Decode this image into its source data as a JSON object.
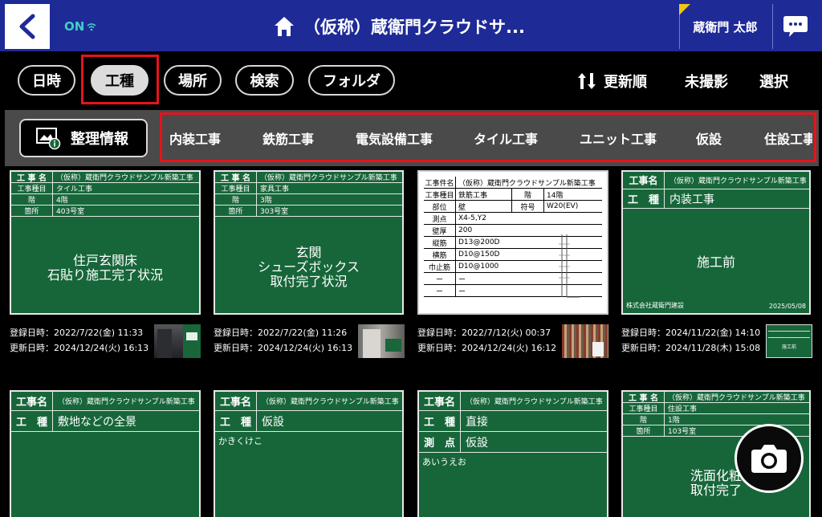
{
  "header": {
    "back_icon": "chevron-left-icon",
    "status_text": "ON",
    "home_icon": "home-icon",
    "title": "（仮称）蔵衛門クラウドサ...",
    "user_name": "蔵衛門 太郎",
    "chat_icon": "chat-bubble-icon",
    "colors": {
      "header_bg": "#1e2a96",
      "accent": "#3fcfc4",
      "flag": "#f2c515"
    }
  },
  "filters": {
    "pills": [
      "日時",
      "工種",
      "場所",
      "検索",
      "フォルダ"
    ],
    "active": "工種",
    "sort_label": "更新順",
    "unshot_label": "未撮影",
    "select_label": "選択"
  },
  "categories": {
    "org_button": "整理情報",
    "items": [
      "内装工事",
      "鉄筋工事",
      "電気設備工事",
      "タイル工事",
      "ユニット工事",
      "仮設",
      "住設工事"
    ]
  },
  "photos": [
    {
      "project": "（仮称）蔵衛門クラウドサンプル新築工事",
      "rows": [
        [
          "工事種目",
          "タイル工事"
        ],
        [
          "階",
          "4階"
        ],
        [
          "箇所",
          "403号室"
        ]
      ],
      "caption": [
        "住戸玄関床",
        "石貼り施工完了状況"
      ],
      "registered": "登録日時：2022/7/22(金) 11:33",
      "updated": "更新日時：2024/12/24(火) 16:13"
    },
    {
      "project": "（仮称）蔵衛門クラウドサンプル新築工事",
      "rows": [
        [
          "工事種目",
          "家具工事"
        ],
        [
          "階",
          "3階"
        ],
        [
          "箇所",
          "303号室"
        ]
      ],
      "caption": [
        "玄関",
        "シューズボックス",
        "取付完了状況"
      ],
      "registered": "登録日時：2022/7/22(金) 11:26",
      "updated": "更新日時：2024/12/24(火) 16:13"
    },
    {
      "project": "（仮称）蔵衛門クラウドサンプル新築工事",
      "white_rows": [
        [
          "工事種目",
          "鉄筋工事",
          "階",
          "14階"
        ],
        [
          "部位",
          "壁",
          "符号",
          "W20(EV)"
        ],
        [
          "測点",
          "X4-5,Y2"
        ],
        [
          "壁厚",
          "200"
        ],
        [
          "縦筋",
          "D13@200D"
        ],
        [
          "横筋",
          "D10@150D"
        ],
        [
          "巾止筋",
          "D10@1000"
        ],
        [
          "ー",
          "ー"
        ],
        [
          "ー",
          "ー"
        ]
      ],
      "white_title_key": "工事件名",
      "registered": "登録日時：2022/7/12(火) 00:37",
      "updated": "更新日時：2024/12/24(火) 16:12"
    },
    {
      "project": "（仮称）蔵衛門クラウドサンプル新築工事",
      "big_rows": [
        [
          "工事名",
          "（仮称）蔵衛門クラウドサンプル新築工事"
        ],
        [
          "工　種",
          "内装工事"
        ]
      ],
      "caption": [
        "施工前"
      ],
      "footer_left": "株式会社蔵衛門建設",
      "footer_right": "2025/05/08",
      "registered": "登録日時：2024/11/22(金) 14:10",
      "updated": "更新日時：2024/11/28(木) 15:08",
      "thumb_text": "施工前"
    },
    {
      "big_rows": [
        [
          "工事名",
          "（仮称）蔵衛門クラウドサンプル新築工事"
        ],
        [
          "工　種",
          "敷地などの全景"
        ]
      ]
    },
    {
      "big_rows": [
        [
          "工事名",
          "（仮称）蔵衛門クラウドサンプル新築工事"
        ],
        [
          "工　種",
          "仮設"
        ]
      ],
      "note": "かきくけこ"
    },
    {
      "big_rows": [
        [
          "工事名",
          "（仮称）蔵衛門クラウドサンプル新築工事"
        ],
        [
          "工　種",
          "直接"
        ],
        [
          "測　点",
          "仮設"
        ]
      ],
      "note": "あいうえお"
    },
    {
      "project": "（仮称）蔵衛門クラウドサンプル新築工事",
      "rows": [
        [
          "工事種目",
          "住設工事"
        ],
        [
          "階",
          "1階"
        ],
        [
          "箇所",
          "103号室"
        ]
      ],
      "caption": [
        "洗面化粧",
        "取付完了"
      ]
    }
  ],
  "camera_icon": "camera-icon",
  "sort_icon": "sort-arrows-icon",
  "info_icon": "image-info-icon"
}
